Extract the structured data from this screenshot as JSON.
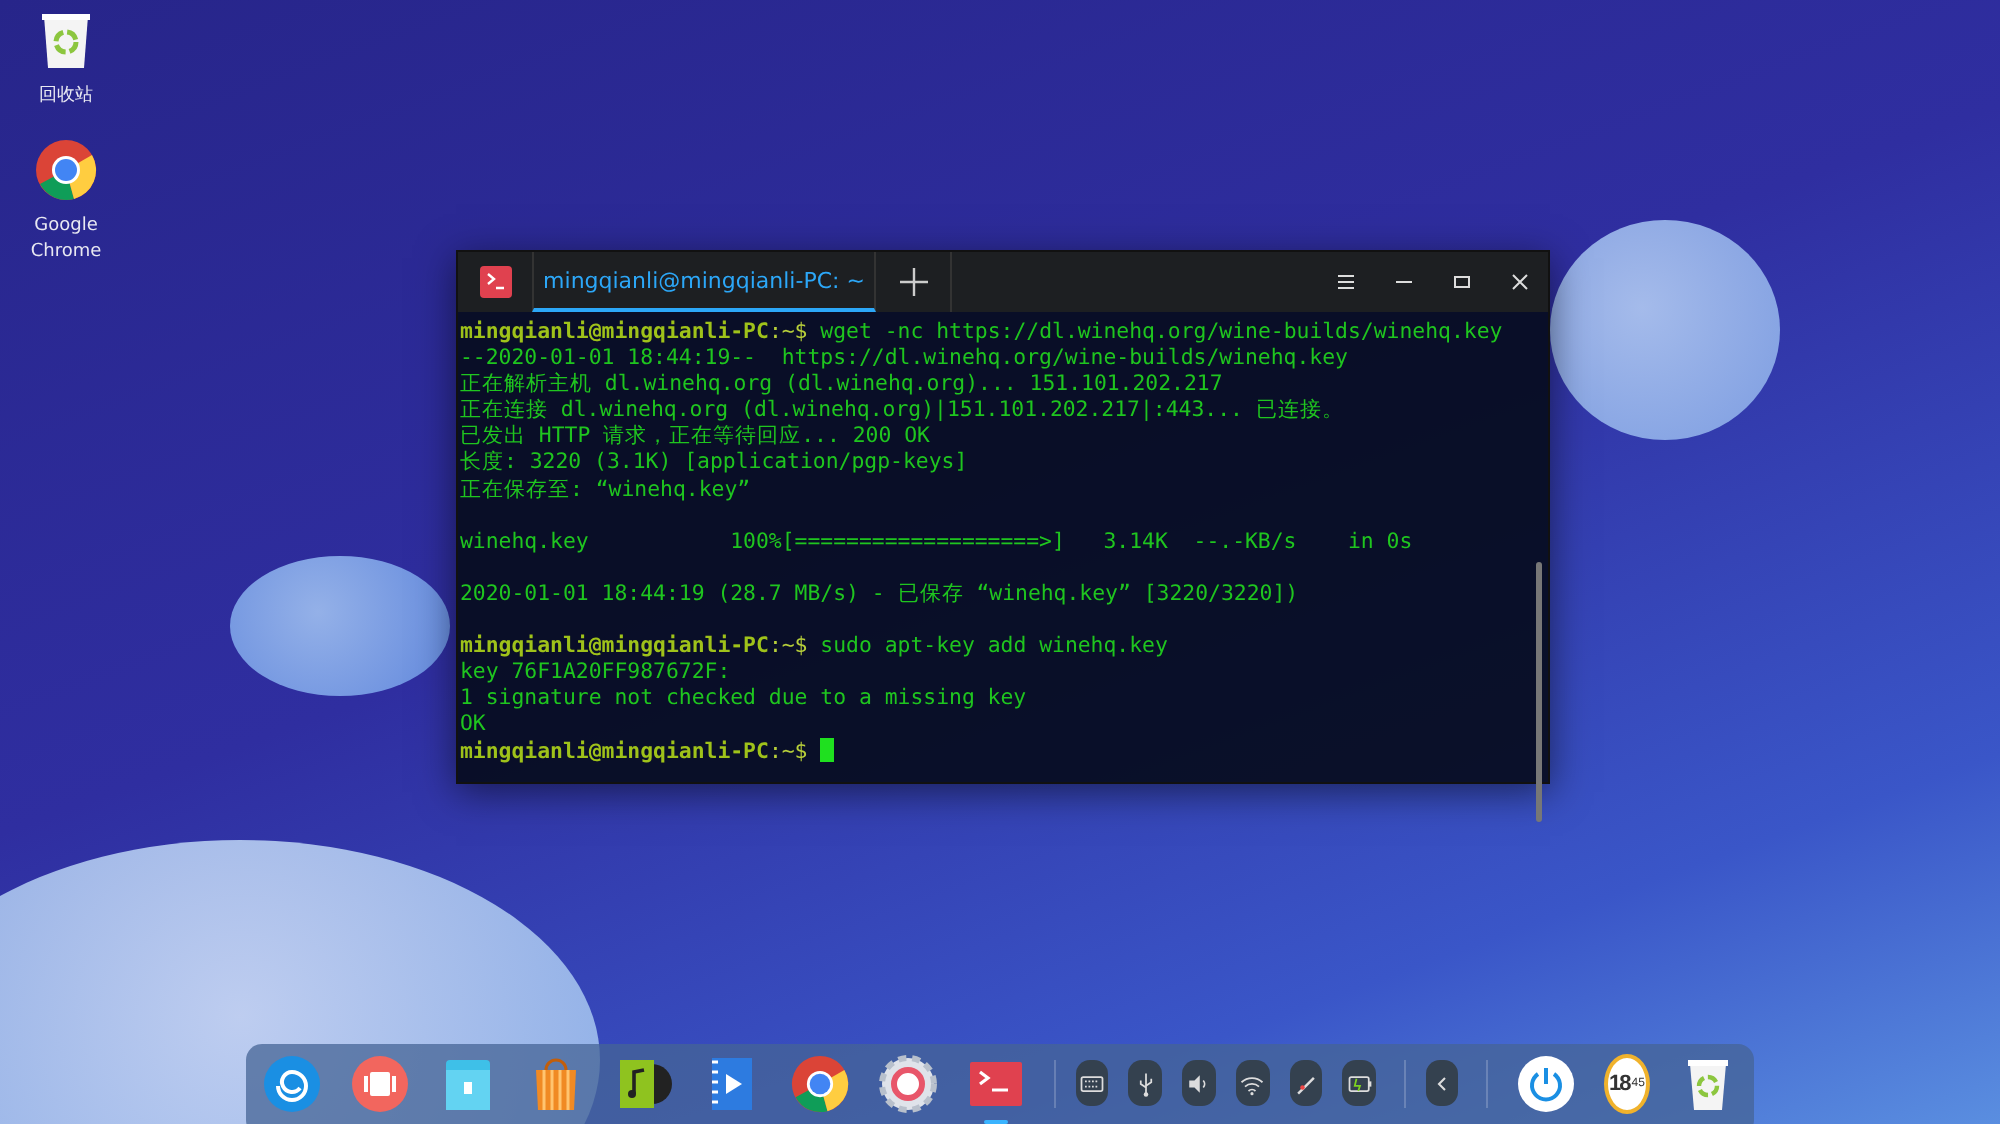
{
  "desktop_icons": [
    {
      "label": "回收站"
    },
    {
      "label": "Google Chrome"
    }
  ],
  "terminal": {
    "tab": {
      "title": "mingqianli@mingqianli-PC: ~",
      "selected": true
    },
    "lines": [
      {
        "kind": "prompt",
        "prompt": "mingqianli@mingqianli-PC",
        "path": ":~$",
        "command": " wget -nc https://dl.winehq.org/wine-builds/winehq.key"
      },
      {
        "kind": "output",
        "text": "--2020-01-01 18:44:19--  https://dl.winehq.org/wine-builds/winehq.key"
      },
      {
        "kind": "output",
        "text": "正在解析主机 dl.winehq.org (dl.winehq.org)... 151.101.202.217"
      },
      {
        "kind": "output",
        "text": "正在连接 dl.winehq.org (dl.winehq.org)|151.101.202.217|:443... 已连接。"
      },
      {
        "kind": "output",
        "text": "已发出 HTTP 请求，正在等待回应... 200 OK"
      },
      {
        "kind": "output",
        "text": "长度: 3220 (3.1K) [application/pgp-keys]"
      },
      {
        "kind": "output",
        "text": "正在保存至: “winehq.key”"
      },
      {
        "kind": "blank"
      },
      {
        "kind": "output",
        "text": "winehq.key           100%[===================>]   3.14K  --.-KB/s    in 0s"
      },
      {
        "kind": "blank"
      },
      {
        "kind": "output",
        "text": "2020-01-01 18:44:19 (28.7 MB/s) - 已保存 “winehq.key” [3220/3220])"
      },
      {
        "kind": "blank"
      },
      {
        "kind": "prompt",
        "prompt": "mingqianli@mingqianli-PC",
        "path": ":~$",
        "command": " sudo apt-key add winehq.key"
      },
      {
        "kind": "output",
        "text": "key 76F1A20FF987672F:"
      },
      {
        "kind": "output",
        "text": "1 signature not checked due to a missing key"
      },
      {
        "kind": "output",
        "text": "OK"
      },
      {
        "kind": "prompt",
        "prompt": "mingqianli@mingqianli-PC",
        "path": ":~$",
        "cursor": true
      }
    ]
  },
  "dock": {
    "apps": [
      {
        "running": false
      },
      {
        "running": false
      },
      {
        "running": false
      },
      {
        "running": false
      },
      {
        "running": false
      },
      {
        "running": false
      },
      {
        "running": false
      },
      {
        "running": false
      },
      {
        "running": true
      }
    ],
    "clock": {
      "hour": "18",
      "minute": "45"
    }
  }
}
